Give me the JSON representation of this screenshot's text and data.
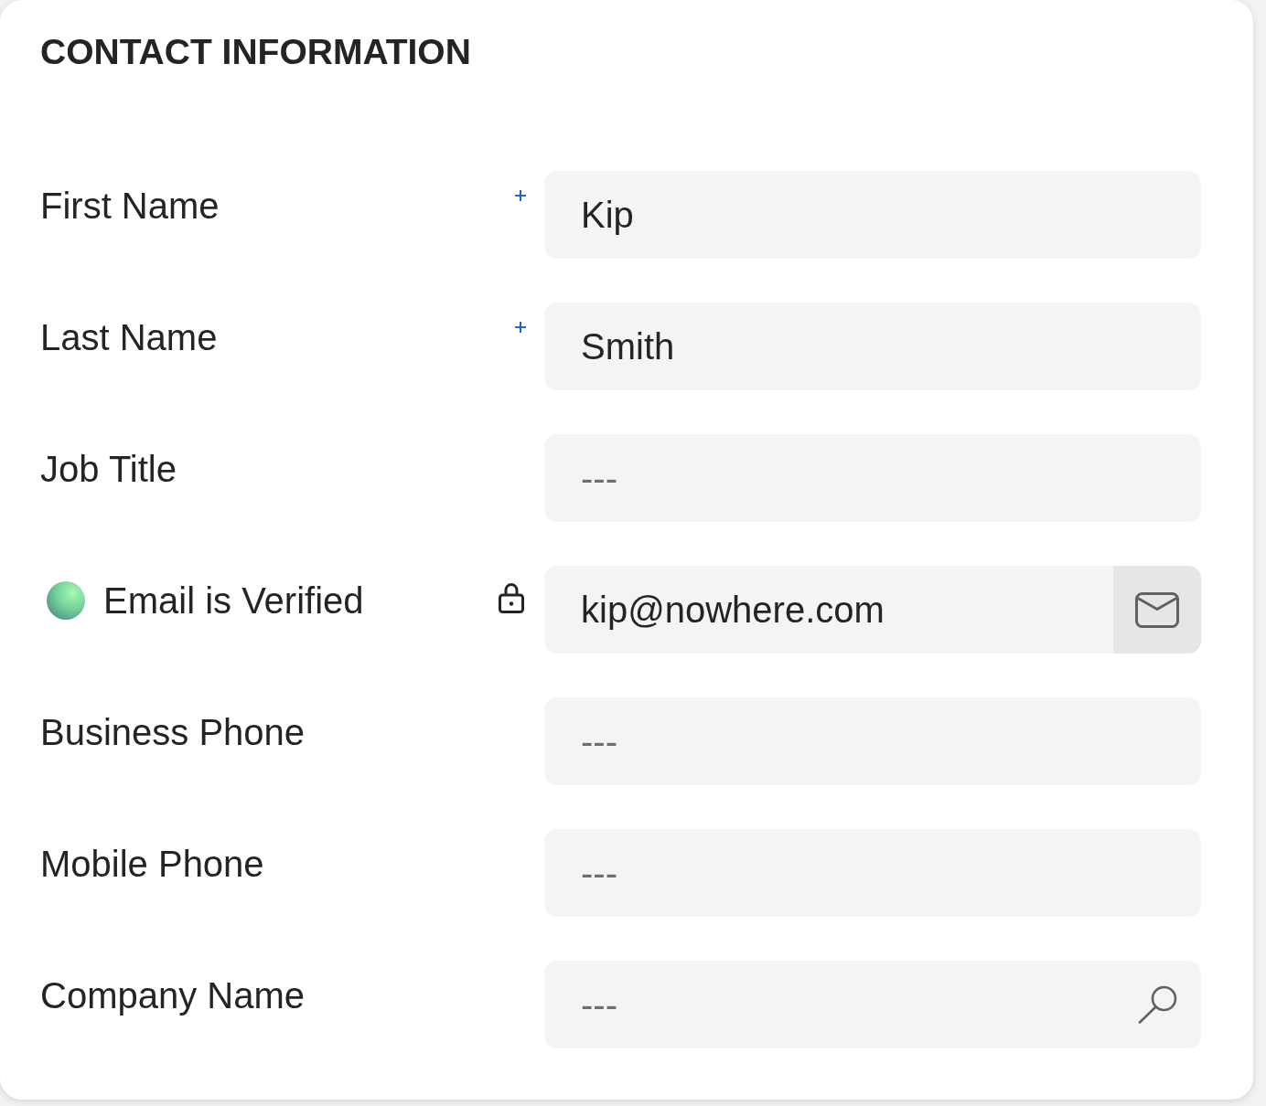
{
  "section": {
    "title": "CONTACT INFORMATION"
  },
  "fields": [
    {
      "kind": "text",
      "label": "First Name",
      "required": true,
      "locked": false,
      "verified": false,
      "value": "Kip"
    },
    {
      "kind": "text",
      "label": "Last Name",
      "required": true,
      "locked": false,
      "verified": false,
      "value": "Smith"
    },
    {
      "kind": "text",
      "label": "Job Title",
      "required": false,
      "locked": false,
      "verified": false,
      "placeholder": "---"
    },
    {
      "kind": "email",
      "label": "Email is Verified",
      "required": false,
      "locked": true,
      "verified": true,
      "value": "kip@nowhere.com"
    },
    {
      "kind": "text",
      "label": "Business Phone",
      "required": false,
      "locked": false,
      "verified": false,
      "placeholder": "---"
    },
    {
      "kind": "text",
      "label": "Mobile Phone",
      "required": false,
      "locked": false,
      "verified": false,
      "placeholder": "---"
    },
    {
      "kind": "lookup",
      "label": "Company Name",
      "required": false,
      "locked": false,
      "verified": false,
      "placeholder": "---"
    }
  ]
}
